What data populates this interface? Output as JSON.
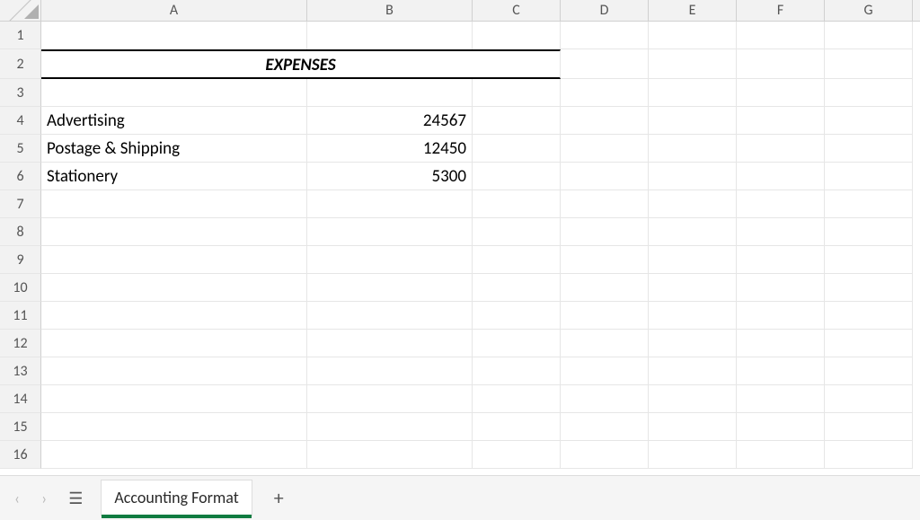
{
  "columns": [
    "A",
    "B",
    "C",
    "D",
    "E",
    "F",
    "G"
  ],
  "rowCount": 16,
  "title": "EXPENSES",
  "content": {
    "r4a": "Advertising",
    "r4b": "24567",
    "r5a": "Postage & Shipping",
    "r5b": "12450",
    "r6a": "Stationery",
    "r6b": "5300"
  },
  "tabs": {
    "activeSheet": "Accounting Format"
  },
  "chart_data": {
    "type": "table",
    "title": "EXPENSES",
    "categories": [
      "Advertising",
      "Postage & Shipping",
      "Stationery"
    ],
    "values": [
      24567,
      12450,
      5300
    ]
  }
}
